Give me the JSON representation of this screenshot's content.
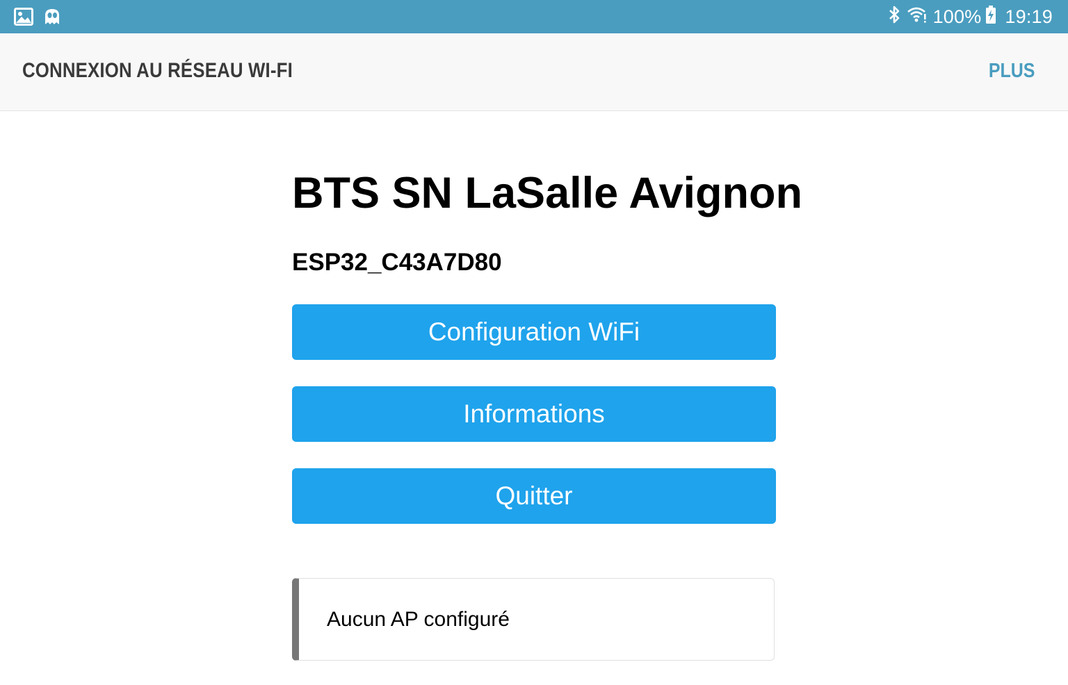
{
  "status_bar": {
    "left_icons": [
      "gallery-icon",
      "ghost-app-icon"
    ],
    "right_icons": [
      "bluetooth-icon",
      "wifi-icon",
      "battery-charging-icon"
    ],
    "battery": "100%",
    "time": "19:19",
    "color": "#4a9dbf"
  },
  "app_bar": {
    "title": "CONNEXION AU RÉSEAU WI-FI",
    "more_label": "PLUS"
  },
  "main": {
    "title": "BTS SN LaSalle Avignon",
    "device_id": "ESP32_C43A7D80",
    "buttons": [
      {
        "label": "Configuration WiFi"
      },
      {
        "label": "Informations"
      },
      {
        "label": "Quitter"
      }
    ],
    "button_color": "#1fa3ec",
    "message": "Aucun AP configuré"
  }
}
